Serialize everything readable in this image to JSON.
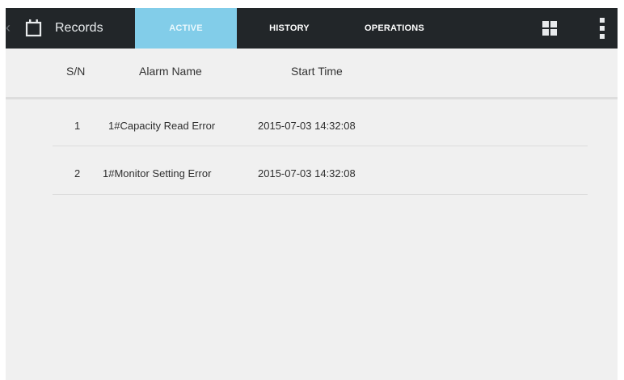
{
  "header": {
    "title": "Records",
    "tabs": [
      {
        "label": "ACTIVE",
        "active": true
      },
      {
        "label": "HISTORY",
        "active": false
      },
      {
        "label": "OPERATIONS",
        "active": false
      }
    ]
  },
  "table": {
    "columns": [
      "S/N",
      "Alarm Name",
      "Start Time"
    ],
    "rows": [
      {
        "sn": "1",
        "alarm": "1#Capacity Read Error",
        "time": "2015-07-03 14:32:08"
      },
      {
        "sn": "2",
        "alarm": "1#Monitor Setting Error",
        "time": "2015-07-03 14:32:08"
      }
    ]
  },
  "colors": {
    "topbar": "#222629",
    "active_tab": "#82cde9",
    "background": "#f0f0f0"
  },
  "icons": [
    "back-chevron-icon",
    "calendar-icon",
    "grid-view-icon",
    "overflow-menu-icon"
  ]
}
